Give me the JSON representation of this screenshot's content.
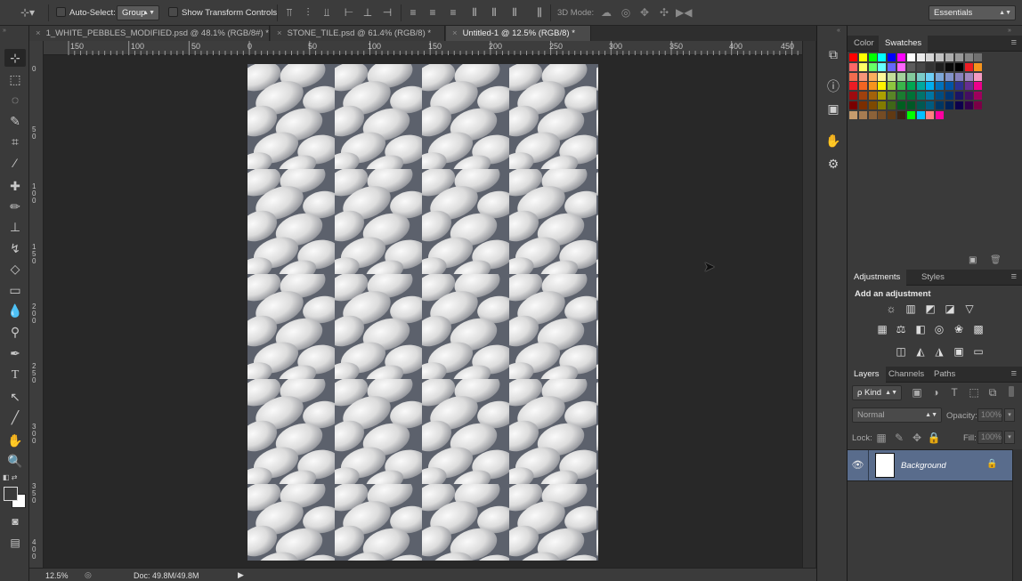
{
  "options_bar": {
    "auto_select_label": "Auto-Select:",
    "auto_select_value": "Group",
    "show_transform_label": "Show Transform Controls",
    "mode_3d_label": "3D Mode:",
    "workspace": "Essentials"
  },
  "tabs": [
    {
      "label": "1_WHITE_PEBBLES_MODIFIED.psd @ 48.1% (RGB/8#) *",
      "close": "×"
    },
    {
      "label": "STONE_TILE.psd @ 61.4% (RGB/8) *",
      "close": "×"
    },
    {
      "label": "Untitled-1 @ 12.5% (RGB/8) *",
      "close": "×"
    }
  ],
  "ruler": {
    "h_labels": [
      "150",
      "100",
      "50",
      "0",
      "50",
      "100",
      "150",
      "200",
      "250",
      "300",
      "350",
      "400",
      "450"
    ],
    "v_labels": [
      "0",
      "5 0",
      "1 0 0",
      "1 5 0",
      "2 0 0",
      "2 5 0",
      "3 0 0",
      "3 5 0",
      "4 0 0"
    ]
  },
  "status": {
    "zoom": "12.5%",
    "doc": "Doc: 49.8M/49.8M"
  },
  "swatches_panel": {
    "tabs": [
      "Color",
      "Swatches"
    ],
    "colors": [
      "#ff0000",
      "#ffff00",
      "#00ff00",
      "#00ffff",
      "#0000ff",
      "#ff00ff",
      "#ffffff",
      "#ebebeb",
      "#d6d6d6",
      "#c2c2c2",
      "#adadad",
      "#999999",
      "#858585",
      "#707070",
      "#ff6666",
      "#ffff66",
      "#66ff66",
      "#66ffff",
      "#6666ff",
      "#ff66ff",
      "#5c5c5c",
      "#474747",
      "#333333",
      "#1f1f1f",
      "#0a0a0a",
      "#000000",
      "#ee1d24",
      "#f7941d",
      "#f26c4f",
      "#f69679",
      "#fbaf5c",
      "#fff799",
      "#c4df9b",
      "#a3d39c",
      "#82ca9c",
      "#7accc8",
      "#6dcff6",
      "#7da7d8",
      "#8393ca",
      "#8781bd",
      "#a186be",
      "#f49ac1",
      "#ed1c24",
      "#f26522",
      "#f7941d",
      "#fff200",
      "#8dc63f",
      "#39b54a",
      "#00a651",
      "#00a99d",
      "#00aeef",
      "#0072bc",
      "#0054a6",
      "#2e3192",
      "#662d91",
      "#ec008c",
      "#9e0b0f",
      "#a0410d",
      "#a3620a",
      "#aba000",
      "#598527",
      "#1a7b30",
      "#007236",
      "#00746b",
      "#0076a3",
      "#004b80",
      "#003471",
      "#1b1464",
      "#440e62",
      "#9e005d",
      "#790000",
      "#7b2e00",
      "#7d4900",
      "#827b00",
      "#406618",
      "#005e20",
      "#005826",
      "#005952",
      "#005b7f",
      "#003663",
      "#002157",
      "#0d004c",
      "#32004b",
      "#7b0046",
      "#c69c6d",
      "#a67c52",
      "#8c6239",
      "#754c24",
      "#603913",
      "#3c2415",
      "#00ff00",
      "#00c0ff",
      "#ff8080",
      "#ff00a0"
    ],
    "footer_icons": [
      "new-swatch-icon",
      "trash-icon"
    ]
  },
  "adjustments_panel": {
    "tabs": [
      "Adjustments",
      "Styles"
    ],
    "heading": "Add an adjustment",
    "icons": [
      "☼",
      "▥",
      "◩",
      "◪",
      "▽",
      "▦",
      "⚖",
      "◧",
      "◎",
      "❀",
      "▩",
      "◫",
      "◭",
      "◮",
      "▣",
      "▭"
    ]
  },
  "layers_panel": {
    "tabs": [
      "Layers",
      "Channels",
      "Paths"
    ],
    "filter_kind": "ρ Kind",
    "blend_mode": "Normal",
    "opacity_label": "Opacity:",
    "opacity_value": "100%",
    "lock_label": "Lock:",
    "fill_label": "Fill:",
    "fill_value": "100%",
    "layers": [
      {
        "name": "Background",
        "visible": true,
        "locked": true
      }
    ]
  }
}
